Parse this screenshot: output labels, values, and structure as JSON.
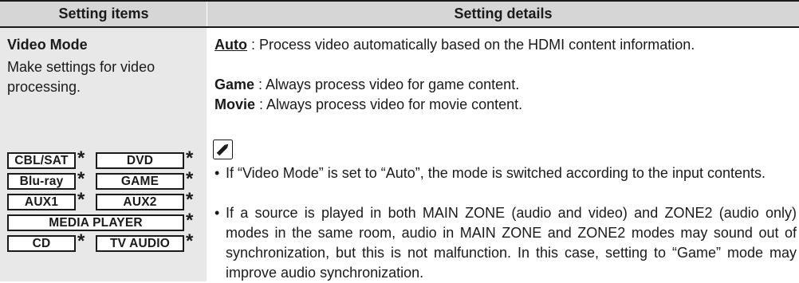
{
  "header": {
    "left": "Setting items",
    "right": "Setting details"
  },
  "item": {
    "title": "Video Mode",
    "description": "Make settings for video processing."
  },
  "sources": [
    {
      "label": "CBL/SAT",
      "asterisk": "*"
    },
    {
      "label": "DVD",
      "asterisk": "*"
    },
    {
      "label": "Blu-ray",
      "asterisk": "*"
    },
    {
      "label": "GAME",
      "asterisk": "*"
    },
    {
      "label": "AUX1",
      "asterisk": "*"
    },
    {
      "label": "AUX2",
      "asterisk": "*"
    },
    {
      "label": "MEDIA PLAYER",
      "asterisk": "*"
    },
    {
      "label": "CD",
      "asterisk": "*"
    },
    {
      "label": "TV AUDIO",
      "asterisk": "*"
    }
  ],
  "options": [
    {
      "name": "Auto",
      "text": " : Process video automatically based on the HDMI content information."
    },
    {
      "name": "Game",
      "text": " : Always process video for game content."
    },
    {
      "name": "Movie",
      "text": " : Always process video for movie content."
    }
  ],
  "notes_icon": "pencil-icon",
  "notes": [
    "If “Video Mode” is set to “Auto”, the mode is switched according to the input contents.",
    "If a source is played in both MAIN ZONE (audio and video) and ZONE2 (audio only) modes in the same room, audio in MAIN ZONE and ZONE2 modes may sound out of synchronization, but this is not malfunction. In this case, setting to “Game” mode may improve audio synchronization."
  ],
  "colors": {
    "header_bg": "#d6d6d6",
    "left_col_bg": "#e8e8e8",
    "text": "#1a1a1a"
  }
}
